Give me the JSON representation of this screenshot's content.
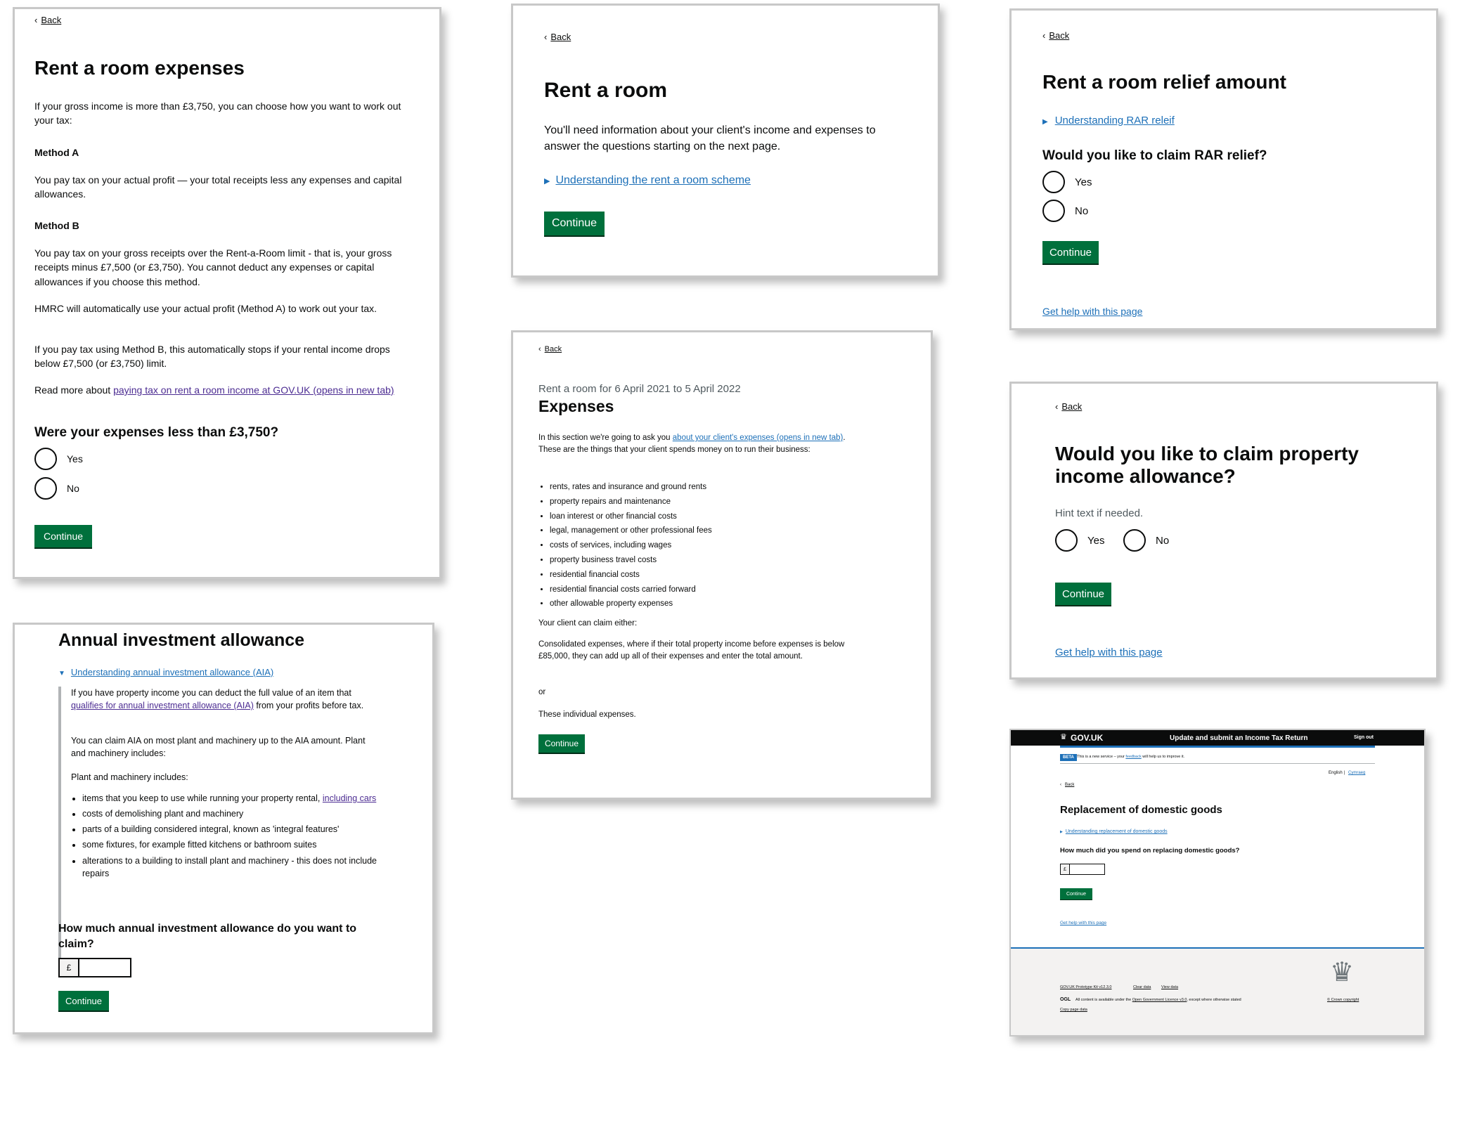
{
  "common": {
    "back": "Back",
    "continue": "Continue",
    "yes": "Yes",
    "no": "No",
    "help": "Get help with this page",
    "currency": "£"
  },
  "card1": {
    "title": "Rent a room expenses",
    "intro": "If your gross income is more than £3,750, you can choose how you want to work out your tax:",
    "method_a_heading": "Method A",
    "method_a_text": "You pay tax on your actual profit — your total receipts less any expenses and capital allowances.",
    "method_b_heading": "Method B",
    "method_b_text": "You pay tax on your gross receipts over the Rent-a-Room limit - that is, your gross receipts minus £7,500 (or £3,750). You cannot deduct any expenses or capital allowances if you choose this method.",
    "hmrc_text": "HMRC will automatically use your actual profit (Method A) to work out your tax.",
    "stops_text": "If you pay tax using Method B, this automatically stops if your rental income drops below £7,500 (or £3,750) limit.",
    "read_more_prefix": "Read more about ",
    "read_more_link": "paying tax on rent a room income at GOV.UK (opens in new tab)",
    "question": "Were your expenses less than £3,750?"
  },
  "card2": {
    "title": "Rent a room",
    "body": "You'll need information about your client's income and expenses to answer the questions starting on the next page.",
    "details": "Understanding the rent a room scheme"
  },
  "card3": {
    "title": "Rent a room relief amount",
    "details": "Understanding RAR releif",
    "question": "Would you like to claim RAR relief?"
  },
  "card4": {
    "title": "Annual investment allowance",
    "details": "Understanding annual investment allowance (AIA)",
    "p1_prefix": "If you have property income you can deduct the full value of an item that ",
    "p1_link": "qualifies for annual investment allowance (AIA)",
    "p1_suffix": " from your profits before tax.",
    "p2": "You can claim AIA on most plant and machinery up to the AIA amount. Plant and machinery includes:",
    "p3": "Plant and machinery includes:",
    "li1_prefix": "items that you keep to use while running your property rental, ",
    "li1_link": "including cars",
    "li2": "costs of demolishing plant and machinery",
    "li3": "parts of a building considered integral, known as 'integral features'",
    "li4": "some fixtures, for example fitted kitchens or bathroom suites",
    "li5": "alterations to a building to install plant and machinery - this does not include repairs",
    "question": "How much annual investment allowance do you want to claim?"
  },
  "card5": {
    "caption": "Rent a room for 6 April 2021 to 5 April 2022",
    "title": "Expenses",
    "intro_prefix": "In this section we're going to ask you ",
    "intro_link": "about your client's expenses (opens in new tab)",
    "intro_suffix": ". These are the things that your client spends money on to run their business:",
    "items": [
      "rents, rates and insurance and ground rents",
      "property repairs and maintenance",
      "loan interest or other financial costs",
      "legal, management or other professional fees",
      "costs of services, including wages",
      "property business travel costs",
      "residential financial costs",
      "residential financial costs carried forward",
      "other allowable property expenses"
    ],
    "either": "Your client can claim either:",
    "consolidated": "Consolidated expenses, where if their total property income before expenses is below £85,000, they can add up all of their expenses and enter the total amount.",
    "or": "or",
    "individual": "These individual expenses."
  },
  "card6": {
    "title": "Would you like to claim property income allowance?",
    "hint": "Hint text if needed."
  },
  "card7": {
    "brand": "GOV.UK",
    "service": "Update and submit an Income Tax Return",
    "sign_out": "Sign out",
    "beta": "BETA",
    "beta_prefix": "This is a new service – your ",
    "beta_link": "feedback",
    "beta_suffix": " will help us to improve it.",
    "lang_english": "English",
    "lang_cymraeg": "Cymraeg",
    "title": "Replacement of domestic goods",
    "details": "Understanding replacement of domestic goods",
    "question": "How much did you spend on replacing domestic goods?",
    "footer_kit": "GOV.UK Prototype Kit v12.3.0",
    "footer_clear": "Clear data",
    "footer_view": "View data",
    "ogl": "OGL",
    "licence_prefix": "All content is available under the ",
    "licence_link": "Open Government Licence v3.0",
    "licence_suffix": ", except where otherwise stated",
    "copy_page": "Copy page data",
    "crown": "© Crown copyright"
  },
  "colors": {
    "button": "#00703c",
    "link": "#1d70b8",
    "header_bg": "#0b0c0c",
    "footer_bg": "#f3f2f1",
    "card_border": "#c8c8c8"
  }
}
